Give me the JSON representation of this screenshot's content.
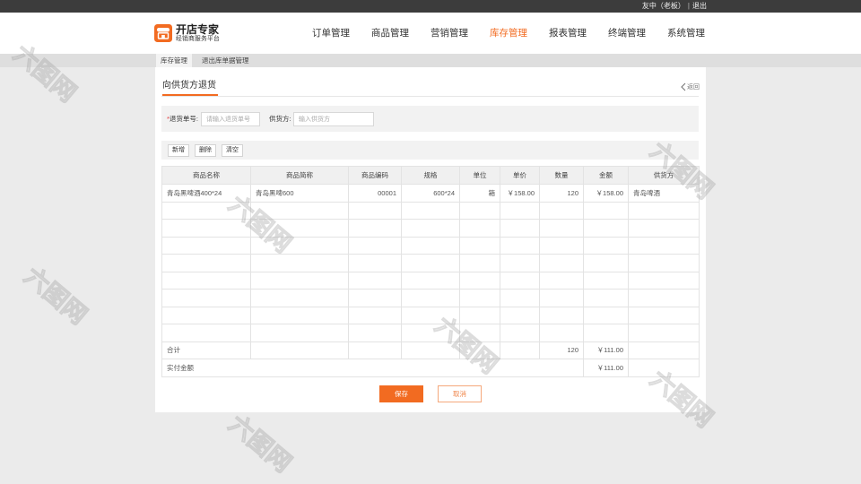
{
  "topbar": {
    "user": "友中（老板）",
    "separator": "|",
    "logout": "退出"
  },
  "logo": {
    "name": "开店专家",
    "tagline": "经销商服务平台",
    "icon": "store-icon"
  },
  "nav": {
    "items": [
      {
        "label": "订单管理",
        "active": false
      },
      {
        "label": "商品管理",
        "active": false
      },
      {
        "label": "营销管理",
        "active": false
      },
      {
        "label": "库存管理",
        "active": true
      },
      {
        "label": "报表管理",
        "active": false
      },
      {
        "label": "终端管理",
        "active": false
      },
      {
        "label": "系统管理",
        "active": false
      }
    ]
  },
  "subnav": {
    "tabs": [
      {
        "label": "库存管理",
        "active": true
      },
      {
        "label": "退出库单据管理",
        "active": false
      }
    ]
  },
  "page": {
    "title": "向供货方退货",
    "back_label": "返回",
    "back_icon": "chevron-left-icon"
  },
  "search": {
    "return_no": {
      "required_mark": "*",
      "label": "退货单号:",
      "value": "",
      "placeholder": "请输入退货单号"
    },
    "supplier": {
      "label": "供货方:",
      "value": "",
      "placeholder": "输入供货方"
    }
  },
  "toolbar": {
    "add": "新增",
    "delete": "删除",
    "clear": "清空"
  },
  "table": {
    "columns": [
      "商品名称",
      "商品简称",
      "商品编码",
      "规格",
      "单位",
      "单价",
      "数量",
      "金额",
      "供货方"
    ],
    "rows": [
      {
        "name": "青岛黑啤酒400*24",
        "short_name": "青岛黑啤600",
        "code": "00001",
        "spec": "600*24",
        "unit": "箱",
        "price": "￥158.00",
        "quantity": "120",
        "amount": "￥158.00",
        "supplier": "青岛啤酒"
      }
    ],
    "total": {
      "label": "合计",
      "quantity": "120",
      "amount": "￥111.00"
    },
    "paid": {
      "label": "实付金额",
      "amount": "￥111.00"
    }
  },
  "actions": {
    "save": "保存",
    "cancel": "取消"
  },
  "watermark": {
    "text": "六图网"
  },
  "colors": {
    "accent": "#f26b21",
    "topbar": "#3c3c3c",
    "page_background": "#ebebeb",
    "required": "#e4393c"
  }
}
